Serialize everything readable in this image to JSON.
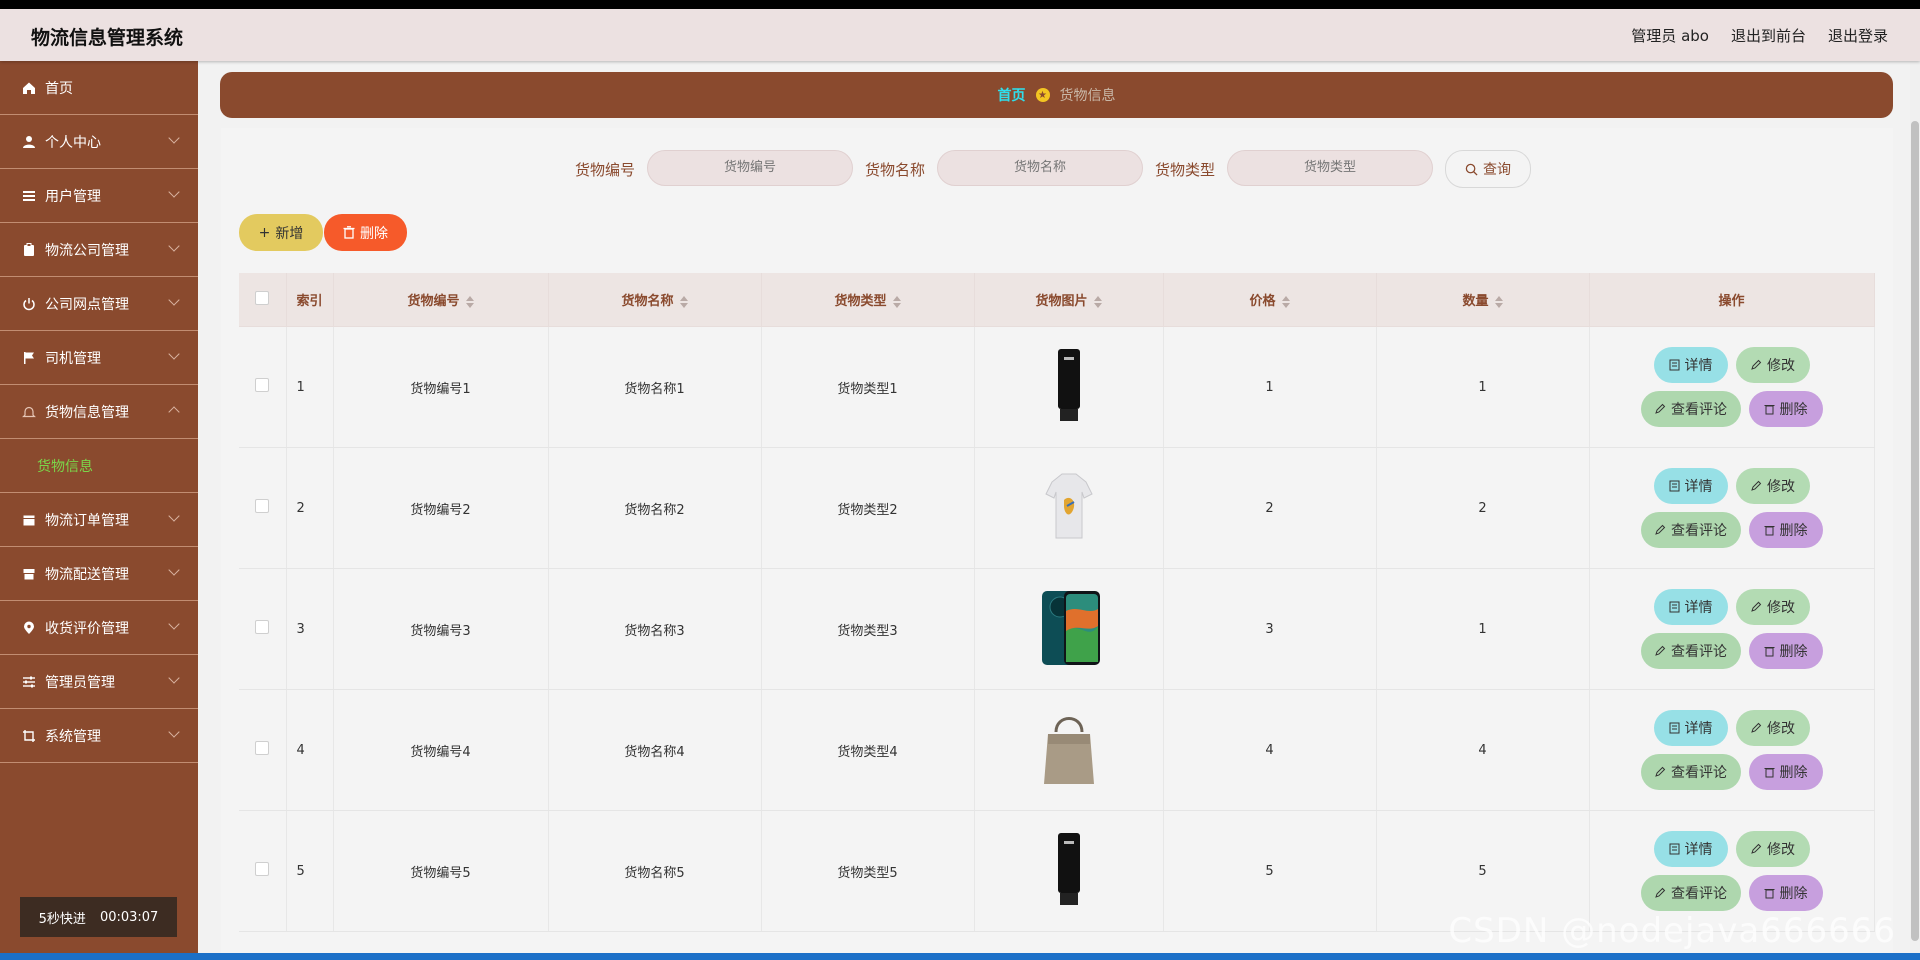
{
  "app": {
    "title": "物流信息管理系统",
    "user_label": "管理员 abo",
    "to_front_label": "退出到前台",
    "logout_label": "退出登录"
  },
  "sidebar": {
    "items": [
      {
        "label": "首页",
        "icon": "home-icon",
        "expandable": false
      },
      {
        "label": "个人中心",
        "icon": "user-icon",
        "expandable": true
      },
      {
        "label": "用户管理",
        "icon": "list-icon",
        "expandable": true
      },
      {
        "label": "物流公司管理",
        "icon": "clipboard-icon",
        "expandable": true
      },
      {
        "label": "公司网点管理",
        "icon": "power-icon",
        "expandable": true
      },
      {
        "label": "司机管理",
        "icon": "flag-icon",
        "expandable": true
      },
      {
        "label": "货物信息管理",
        "icon": "bell-icon",
        "expandable": true,
        "expanded": true
      },
      {
        "label": "物流订单管理",
        "icon": "calendar-icon",
        "expandable": true
      },
      {
        "label": "物流配送管理",
        "icon": "box-icon",
        "expandable": true
      },
      {
        "label": "收货评价管理",
        "icon": "location-icon",
        "expandable": true
      },
      {
        "label": "管理员管理",
        "icon": "sliders-icon",
        "expandable": true
      },
      {
        "label": "系统管理",
        "icon": "crop-icon",
        "expandable": true
      }
    ],
    "submenu_label": "货物信息",
    "timer": {
      "label": "5秒快进",
      "time": "00:03:07"
    }
  },
  "breadcrumb": {
    "home": "首页",
    "current": "货物信息"
  },
  "search": {
    "fields": [
      {
        "label": "货物编号",
        "placeholder": "货物编号"
      },
      {
        "label": "货物名称",
        "placeholder": "货物名称"
      },
      {
        "label": "货物类型",
        "placeholder": "货物类型"
      }
    ],
    "query_label": "查询"
  },
  "actions": {
    "add_label": "新增",
    "delete_label": "删除"
  },
  "table": {
    "headers": {
      "index": "索引",
      "code": "货物编号",
      "name": "货物名称",
      "type": "货物类型",
      "image": "货物图片",
      "price": "价格",
      "quantity": "数量",
      "ops": "操作"
    },
    "rows": [
      {
        "index": "1",
        "code": "货物编号1",
        "name": "货物名称1",
        "type": "货物类型1",
        "image": "cream-tube",
        "price": "1",
        "quantity": "1"
      },
      {
        "index": "2",
        "code": "货物编号2",
        "name": "货物名称2",
        "type": "货物类型2",
        "image": "tshirt",
        "price": "2",
        "quantity": "2"
      },
      {
        "index": "3",
        "code": "货物编号3",
        "name": "货物名称3",
        "type": "货物类型3",
        "image": "phone",
        "price": "3",
        "quantity": "1"
      },
      {
        "index": "4",
        "code": "货物编号4",
        "name": "货物名称4",
        "type": "货物类型4",
        "image": "handbag",
        "price": "4",
        "quantity": "4"
      },
      {
        "index": "5",
        "code": "货物编号5",
        "name": "货物名称5",
        "type": "货物类型5",
        "image": "cream-tube",
        "price": "5",
        "quantity": "5"
      }
    ],
    "op_labels": {
      "detail": "详情",
      "edit": "修改",
      "comment": "查看评论",
      "delete": "删除"
    }
  },
  "watermark": "CSDN @nodejava666666",
  "colors": {
    "sidebar": "#8a4a2e",
    "topbar": "#ece1e1",
    "accent_home": "#2ee0ee",
    "add": "#e3ca5f",
    "delete": "#f65a2a"
  }
}
